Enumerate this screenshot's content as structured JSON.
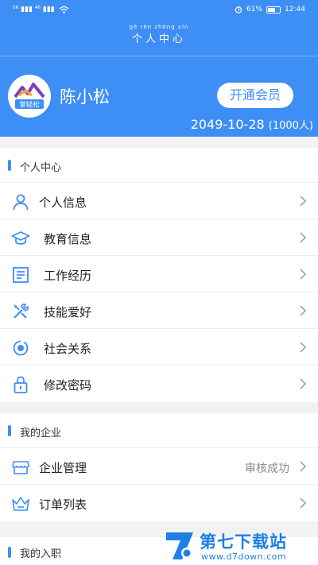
{
  "statusbar": {
    "signal": "⁵⁶ ▮▮▮ ⁴⁶ ▮▮▮",
    "battery_percent": "61%",
    "battery_level": 0.61,
    "time": "12:44"
  },
  "header": {
    "pinyin": "gè rén zhōng xīn",
    "title": "个人中心",
    "username": "陈小松",
    "vip_button": "开通会员",
    "expiry_date": "2049-10-28",
    "expiry_count": "(1000人)",
    "avatar_text": "掌轻松"
  },
  "sections": {
    "personal": {
      "title": "个人中心",
      "items": [
        {
          "label": "个人信息",
          "icon": "user-icon"
        },
        {
          "label": "教育信息",
          "icon": "graduation-cap-icon"
        },
        {
          "label": "工作经历",
          "icon": "document-icon"
        },
        {
          "label": "技能爱好",
          "icon": "tools-icon"
        },
        {
          "label": "社会关系",
          "icon": "social-icon"
        },
        {
          "label": "修改密码",
          "icon": "lock-icon"
        }
      ]
    },
    "company": {
      "title": "我的企业",
      "items": [
        {
          "label": "企业管理",
          "value": "审核成功",
          "icon": "store-icon"
        },
        {
          "label": "订单列表",
          "icon": "basket-icon"
        }
      ]
    },
    "job": {
      "title": "我的入职"
    }
  },
  "watermark": {
    "text": "第七下载站",
    "url": "www.d7down.com"
  },
  "colors": {
    "primary": "#3d8ef5",
    "background": "#f2f2f2"
  }
}
